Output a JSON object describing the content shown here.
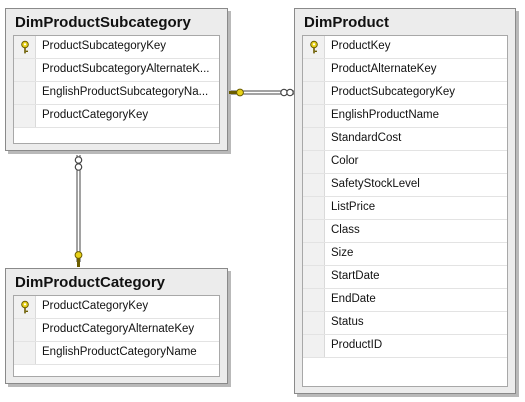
{
  "tables": [
    {
      "name": "DimProductSubcategory",
      "columns": [
        {
          "label": "ProductSubcategoryKey",
          "primary_key": true
        },
        {
          "label": "ProductSubcategoryAlternateK...",
          "primary_key": false
        },
        {
          "label": "EnglishProductSubcategoryNa...",
          "primary_key": false
        },
        {
          "label": "ProductCategoryKey",
          "primary_key": false
        }
      ]
    },
    {
      "name": "DimProduct",
      "columns": [
        {
          "label": "ProductKey",
          "primary_key": true
        },
        {
          "label": "ProductAlternateKey",
          "primary_key": false
        },
        {
          "label": "ProductSubcategoryKey",
          "primary_key": false
        },
        {
          "label": "EnglishProductName",
          "primary_key": false
        },
        {
          "label": "StandardCost",
          "primary_key": false
        },
        {
          "label": "Color",
          "primary_key": false
        },
        {
          "label": "SafetyStockLevel",
          "primary_key": false
        },
        {
          "label": "ListPrice",
          "primary_key": false
        },
        {
          "label": "Class",
          "primary_key": false
        },
        {
          "label": "Size",
          "primary_key": false
        },
        {
          "label": "StartDate",
          "primary_key": false
        },
        {
          "label": "EndDate",
          "primary_key": false
        },
        {
          "label": "Status",
          "primary_key": false
        },
        {
          "label": "ProductID",
          "primary_key": false
        }
      ]
    },
    {
      "name": "DimProductCategory",
      "columns": [
        {
          "label": "ProductCategoryKey",
          "primary_key": true
        },
        {
          "label": "ProductCategoryAlternateKey",
          "primary_key": false
        },
        {
          "label": "EnglishProductCategoryName",
          "primary_key": false
        }
      ]
    }
  ],
  "relationships": [
    {
      "from": "DimProduct",
      "to": "DimProductSubcategory"
    },
    {
      "from": "DimProductSubcategory",
      "to": "DimProductCategory"
    }
  ],
  "colors": {
    "key_icon": "#e8d21a",
    "connector": "#444444"
  }
}
